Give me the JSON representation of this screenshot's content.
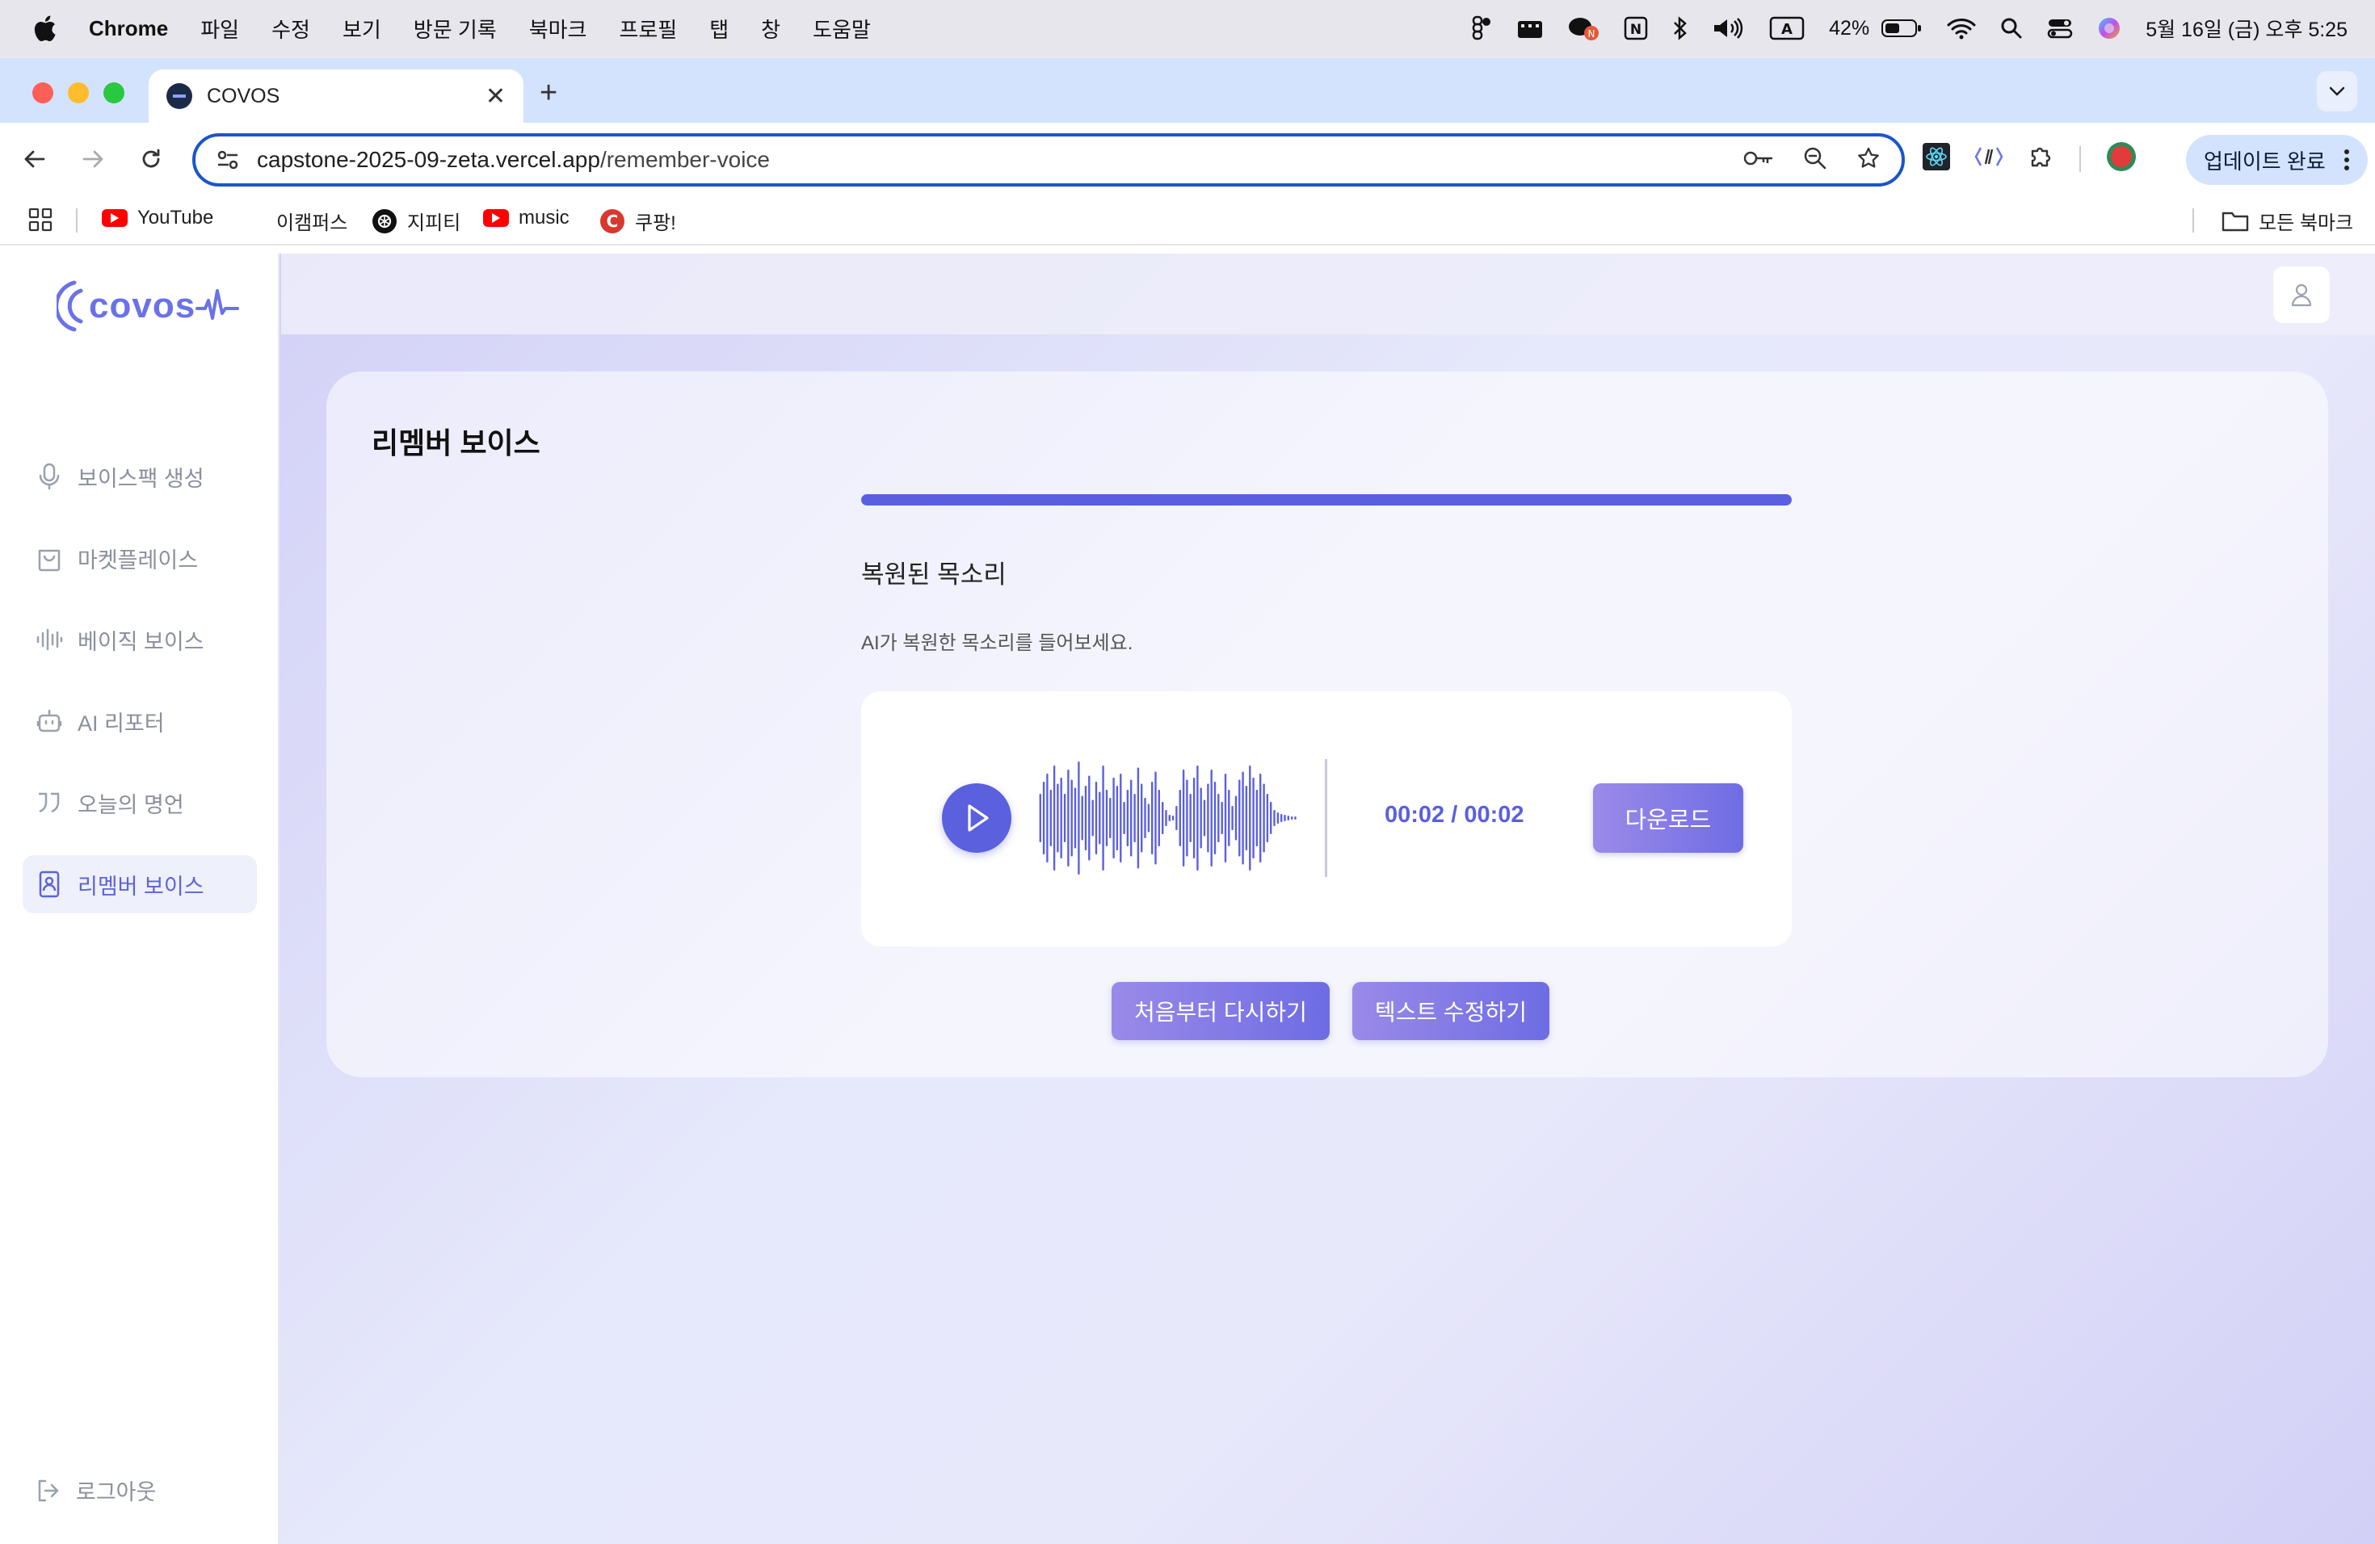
{
  "menubar": {
    "app": "Chrome",
    "items": [
      "파일",
      "수정",
      "보기",
      "방문 기록",
      "북마크",
      "프로필",
      "탭",
      "창",
      "도움말"
    ],
    "battery": "42%",
    "datetime": "5월 16일 (금) 오후 5:25"
  },
  "browser": {
    "tab_title": "COVOS",
    "url_host": "capstone-2025-09-zeta.vercel.app",
    "url_path": "/remember-voice",
    "update_label": "업데이트 완료",
    "bookmarks": [
      "YouTube",
      "이캠퍼스",
      "지피티",
      "music",
      "쿠팡!"
    ],
    "all_bookmarks": "모든 북마크"
  },
  "app": {
    "logo": "covos",
    "nav": [
      {
        "label": "보이스팩 생성",
        "icon": "microphone-icon"
      },
      {
        "label": "마켓플레이스",
        "icon": "shopping-bag-icon"
      },
      {
        "label": "베이직 보이스",
        "icon": "audio-lines-icon"
      },
      {
        "label": "AI 리포터",
        "icon": "bot-icon"
      },
      {
        "label": "오늘의 명언",
        "icon": "quote-icon"
      },
      {
        "label": "리멤버 보이스",
        "icon": "contact-book-icon",
        "active": true
      }
    ],
    "logout": "로그아웃"
  },
  "main": {
    "title": "리멤버 보이스",
    "progress": 1.0,
    "section_title": "복원된 목소리",
    "section_desc": "AI가 복원한 목소리를 들어보세요.",
    "player": {
      "time": "00:02 / 00:02",
      "download_label": "다운로드"
    },
    "restart_label": "처음부터 다시하기",
    "edit_text_label": "텍스트 수정하기"
  },
  "colors": {
    "accent": "#5a5fe0",
    "button_gradient_start": "#9b8be8",
    "button_gradient_end": "#6f6ce4"
  }
}
